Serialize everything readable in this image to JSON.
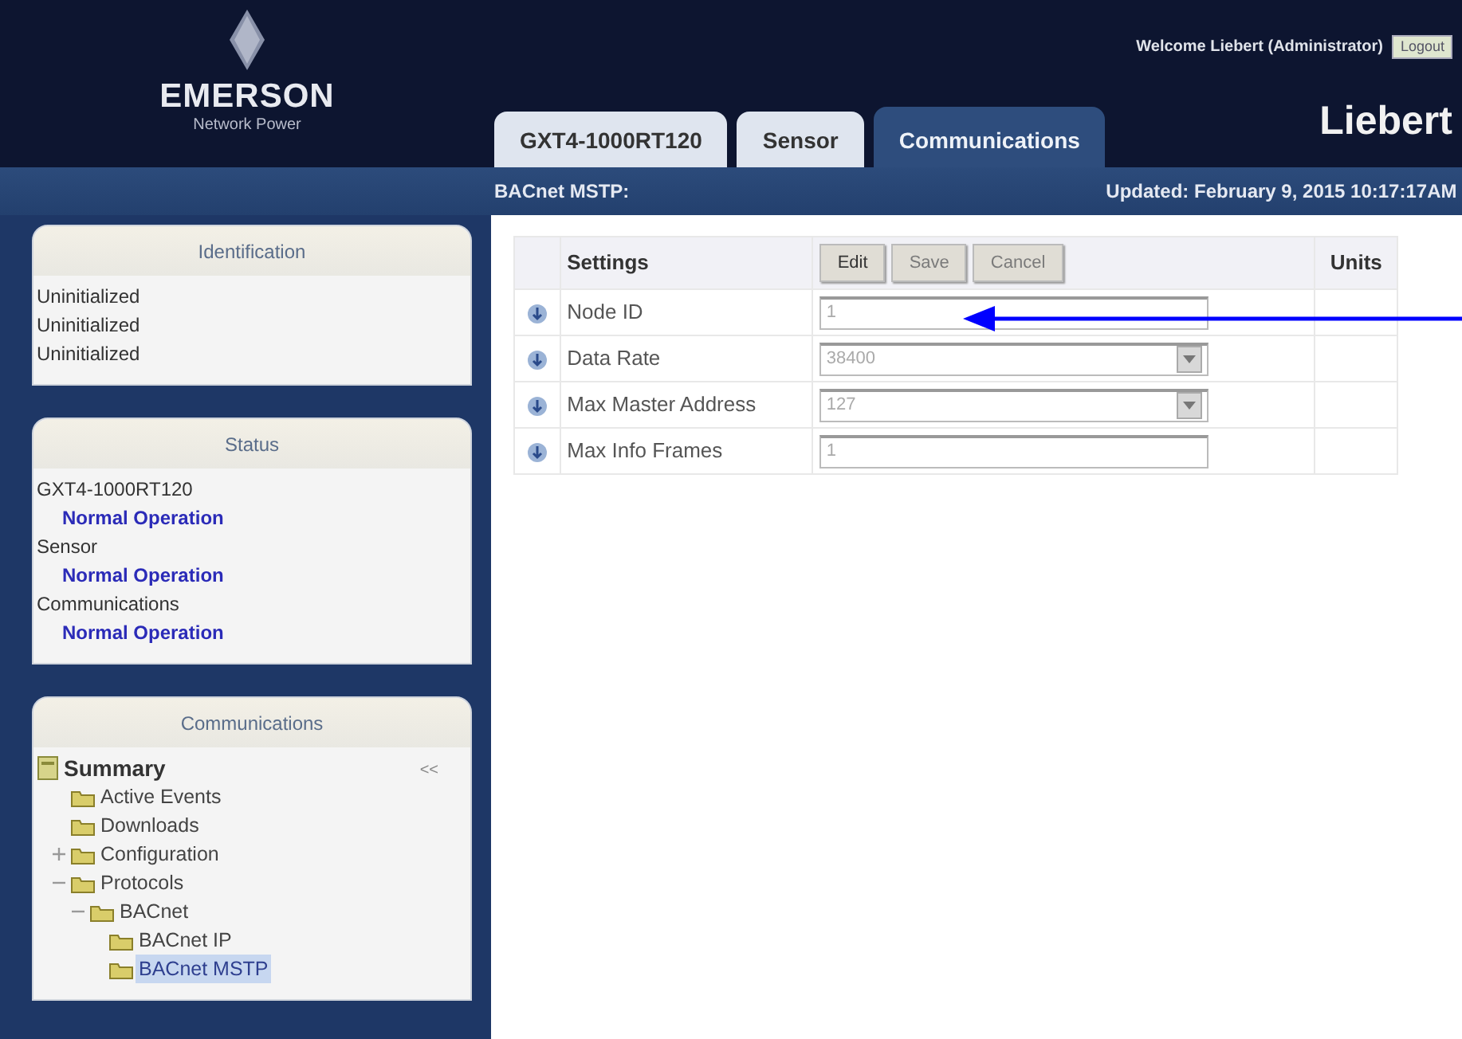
{
  "header": {
    "brand": "EMERSON",
    "brand_sub": "Network Power",
    "welcome": "Welcome Liebert (Administrator)",
    "logout": "Logout",
    "product": "Liebert"
  },
  "tabs": [
    {
      "label": "GXT4-1000RT120",
      "selected": false
    },
    {
      "label": "Sensor",
      "selected": false
    },
    {
      "label": "Communications",
      "selected": true
    }
  ],
  "subbar": {
    "page": "BACnet MSTP:",
    "updated": "Updated: February 9, 2015 10:17:17AM"
  },
  "identification": {
    "title": "Identification",
    "lines": [
      "Uninitialized",
      "Uninitialized",
      "Uninitialized"
    ]
  },
  "status": {
    "title": "Status",
    "items": [
      {
        "device": "GXT4-1000RT120",
        "state": "Normal Operation"
      },
      {
        "device": "Sensor",
        "state": "Normal Operation"
      },
      {
        "device": "Communications",
        "state": "Normal Operation"
      }
    ]
  },
  "nav_tree": {
    "title": "Communications",
    "collapse": "<<",
    "items": [
      {
        "label": "Summary",
        "kind": "root",
        "selected": false,
        "children": [
          {
            "label": "Active Events",
            "kind": "folder",
            "selected": false
          },
          {
            "label": "Downloads",
            "kind": "folder",
            "selected": false
          },
          {
            "label": "Configuration",
            "kind": "folder",
            "selected": false,
            "expanded": false
          },
          {
            "label": "Protocols",
            "kind": "folder",
            "selected": false,
            "expanded": true,
            "children": [
              {
                "label": "BACnet",
                "kind": "folder",
                "selected": false,
                "expanded": true,
                "children": [
                  {
                    "label": "BACnet IP",
                    "kind": "folder",
                    "selected": false
                  },
                  {
                    "label": "BACnet MSTP",
                    "kind": "folder",
                    "selected": true
                  }
                ]
              }
            ]
          }
        ]
      }
    ]
  },
  "settings": {
    "columns": [
      "Settings",
      "Units"
    ],
    "buttons": [
      {
        "label": "Edit",
        "disabled": false
      },
      {
        "label": "Save",
        "disabled": true
      },
      {
        "label": "Cancel",
        "disabled": true
      }
    ],
    "rows": [
      {
        "name": "Node ID",
        "kind": "text",
        "value": "1",
        "disabled": true
      },
      {
        "name": "Data Rate",
        "kind": "select",
        "value": "38400",
        "disabled": true
      },
      {
        "name": "Max Master Address",
        "kind": "select",
        "value": "127",
        "disabled": true
      },
      {
        "name": "Max Info Frames",
        "kind": "text",
        "value": "1",
        "disabled": true
      }
    ]
  }
}
